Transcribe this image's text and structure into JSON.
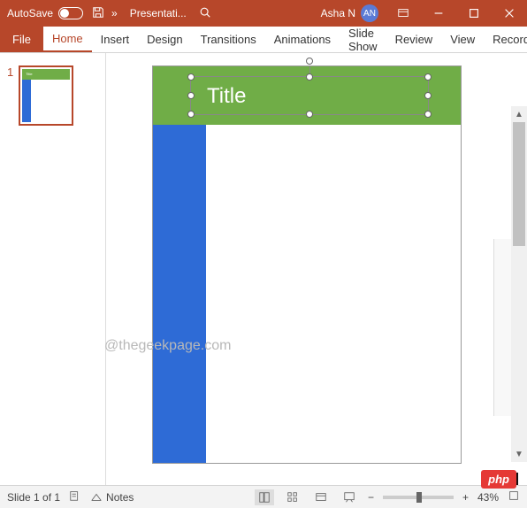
{
  "titlebar": {
    "autosave_label": "AutoSave",
    "autosave_on": false,
    "file_name": "Presentati...",
    "user_name": "Asha N",
    "user_initials": "AN"
  },
  "ribbon": {
    "tabs": [
      "File",
      "Home",
      "Insert",
      "Design",
      "Transitions",
      "Animations",
      "Slide Show",
      "Review",
      "View",
      "Recordi"
    ],
    "active": "Home"
  },
  "slides": {
    "current_number": "1",
    "title_text": "Title",
    "thumb_title": "Title"
  },
  "statusbar": {
    "slide_indicator": "Slide 1 of 1",
    "notes_label": "Notes",
    "zoom_value": "43%"
  },
  "watermark": "@thegeekpage.com",
  "badge": "php"
}
